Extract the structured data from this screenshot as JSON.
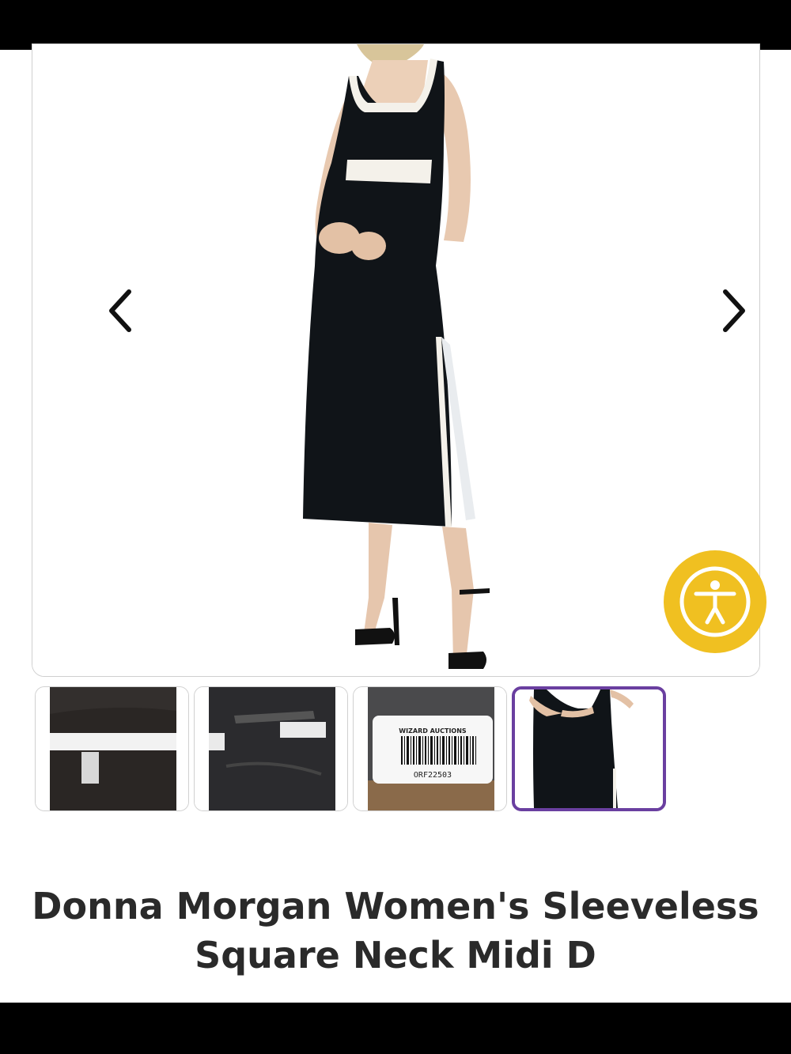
{
  "product": {
    "title": "Donna Morgan Women's Sleeveless Square Neck Midi D"
  },
  "gallery": {
    "main_image_alt": "Model wearing black sleeveless square neck midi dress with white trim",
    "prev_icon": "chevron-left-icon",
    "next_icon": "chevron-right-icon",
    "thumbnails": [
      {
        "name": "thumbnail-1",
        "active": false
      },
      {
        "name": "thumbnail-2",
        "active": false
      },
      {
        "name": "thumbnail-3",
        "active": false,
        "label_company": "WIZARD AUCTIONS",
        "label_code": "ORF22503"
      },
      {
        "name": "thumbnail-4",
        "active": true
      }
    ]
  },
  "accessibility": {
    "icon": "accessibility-icon"
  },
  "colors": {
    "accent_active": "#6a3fa0",
    "accessibility_bg": "#f0c021",
    "title_text": "#2a2a2a"
  }
}
